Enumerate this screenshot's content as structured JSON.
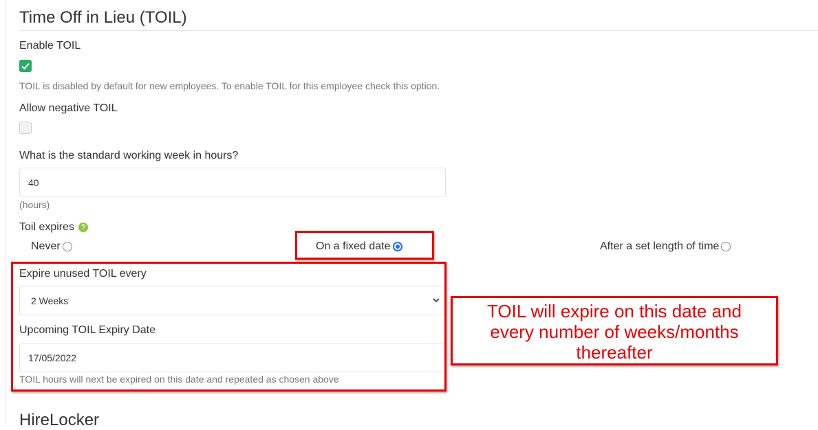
{
  "toil": {
    "title": "Time Off in Lieu (TOIL)",
    "enable_label": "Enable TOIL",
    "enable_checked": true,
    "enable_help": "TOIL is disabled by default for new employees. To enable TOIL for this employee check this option.",
    "negative_label": "Allow negative TOIL",
    "negative_checked": false,
    "week_label": "What is the standard working week in hours?",
    "week_value": "40",
    "week_unit": "(hours)",
    "expires_label": "Toil expires",
    "expires_options": [
      {
        "label": "Never",
        "selected": false
      },
      {
        "label": "On a fixed date",
        "selected": true
      },
      {
        "label": "After a set length of time",
        "selected": false
      }
    ],
    "expire_every_label": "Expire unused TOIL every",
    "expire_every_value": "2 Weeks",
    "upcoming_label": "Upcoming TOIL Expiry Date",
    "upcoming_value": "17/05/2022",
    "upcoming_help": "TOIL hours will next be expired on this date and repeated as chosen above"
  },
  "annotation": {
    "line1": "TOIL will expire on this date and",
    "line2": "every number of weeks/months",
    "line3": "thereafter"
  },
  "next_section_title": "HireLocker",
  "colors": {
    "checkbox_checked": "#27ae60",
    "radio_selected": "#1a73e8",
    "help_icon": "#8cc63e",
    "annotation_red": "#e60000"
  },
  "icons": {
    "check": "check-icon",
    "help": "question-circle-icon",
    "select": "chevron-down-icon"
  }
}
